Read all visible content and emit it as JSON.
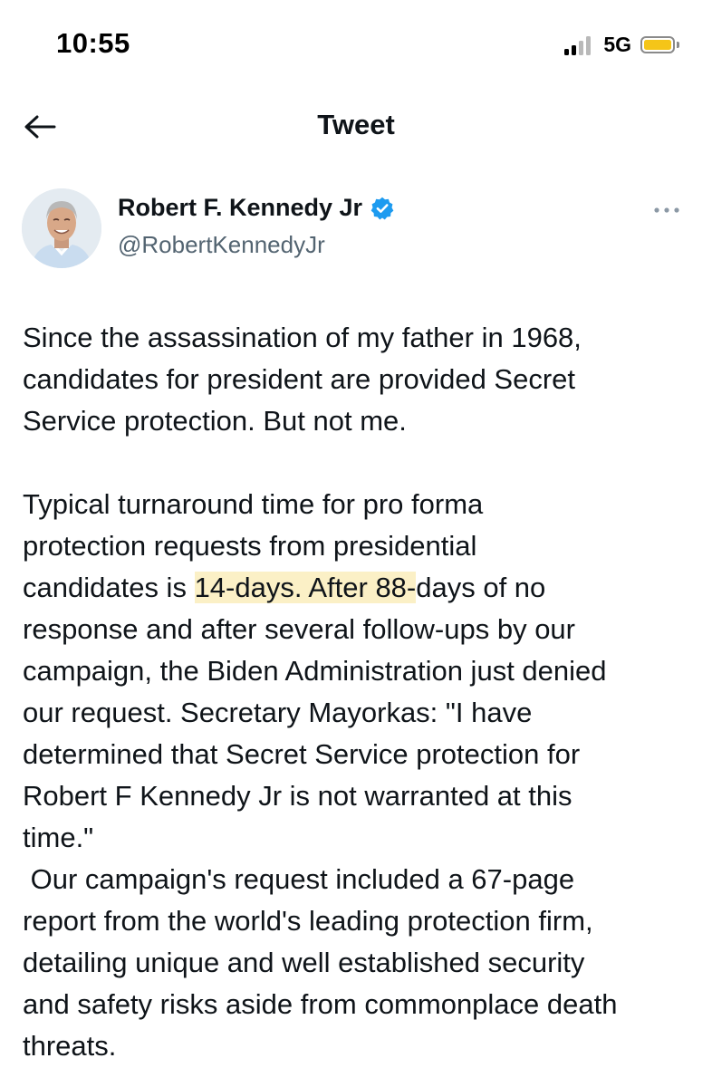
{
  "status_bar": {
    "time": "10:55",
    "network": "5G",
    "colors": {
      "battery": "#f5c518"
    }
  },
  "header": {
    "title": "Tweet",
    "back_icon": "arrow-left-icon"
  },
  "author": {
    "display_name": "Robert F. Kennedy Jr",
    "handle": "@RobertKennedyJr",
    "verified": true,
    "verified_icon": "verified-badge-icon",
    "more_icon": "more-horizontal-icon",
    "colors": {
      "verified": "#1d9bf0",
      "handle": "#536471"
    }
  },
  "tweet": {
    "para1": {
      "l1": "Since the assassination of my father in 1968,",
      "l2": "candidates for president are provided Secret",
      "l3": "Service protection.  But not me."
    },
    "para2": {
      "l1": "Typical turnaround time for pro forma",
      "l2": "protection requests from presidential",
      "l3_pre": "candidates is ",
      "l3_highlight": "14-days.  After 88-",
      "l3_post": "days of no",
      "l4": "response and after several follow-ups by our",
      "l5": "campaign, the Biden Administration just denied",
      "l6": "our request.  Secretary Mayorkas: \"I have",
      "l7": "determined that Secret Service protection for",
      "l8": "Robert F Kennedy Jr is not warranted at this",
      "l9": "time.\""
    },
    "para3": {
      "l1": " Our campaign's request included a 67-page",
      "l2": "report from the world's leading protection firm,",
      "l3": "detailing unique and well established security",
      "l4": "and safety risks aside from commonplace death",
      "l5": "threats."
    },
    "colors": {
      "highlight": "#fbf0c6",
      "text": "#0f1419"
    }
  }
}
